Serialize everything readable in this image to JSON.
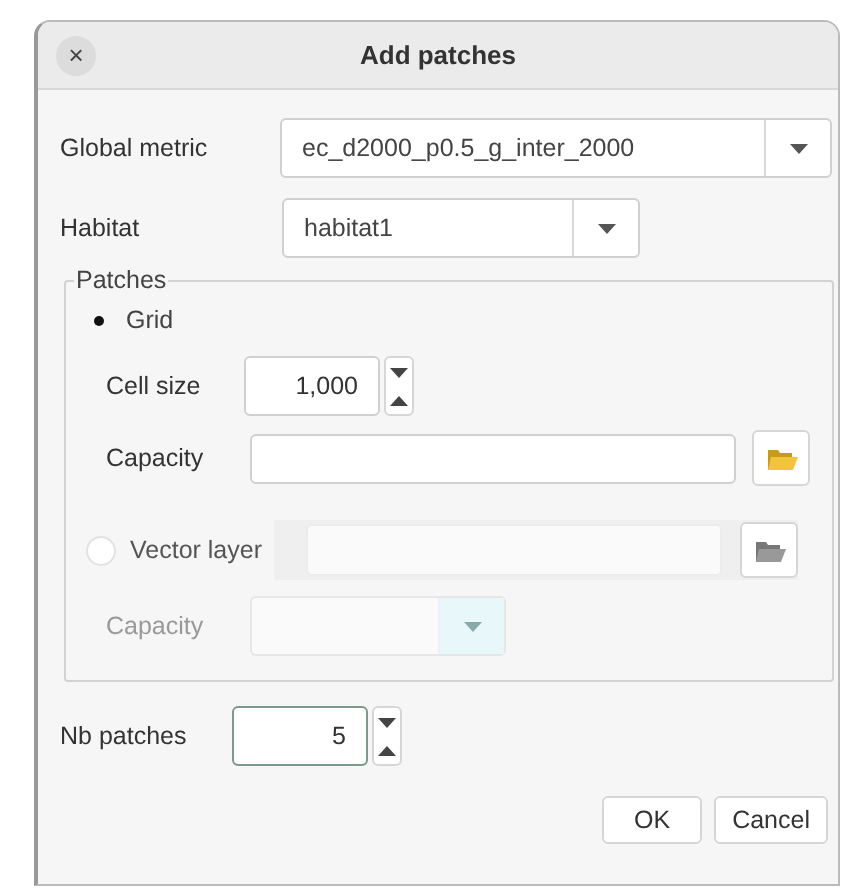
{
  "window": {
    "title": "Add patches",
    "close": "×"
  },
  "global_metric": {
    "label": "Global metric",
    "value": "ec_d2000_p0.5_g_inter_2000"
  },
  "habitat": {
    "label": "Habitat",
    "value": "habitat1"
  },
  "patches": {
    "title": "Patches",
    "grid": {
      "label": "Grid",
      "selected": true,
      "cell_size": {
        "label": "Cell size",
        "value": "1,000"
      },
      "capacity": {
        "label": "Capacity"
      }
    },
    "vector": {
      "label": "Vector layer",
      "selected": false,
      "disabled": true,
      "capacity": {
        "label": "Capacity"
      }
    }
  },
  "nb_patches": {
    "label": "Nb patches",
    "value": "5"
  },
  "buttons": [
    {
      "label": "OK"
    },
    {
      "label": "Cancel"
    }
  ]
}
